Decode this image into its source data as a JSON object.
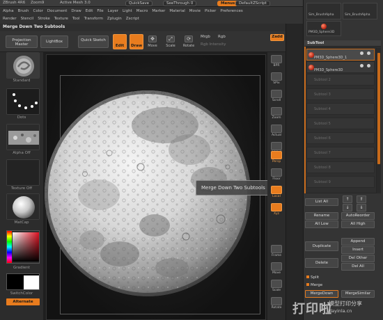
{
  "title_bar": {
    "items": [
      "ZBrush 4R6",
      "Zoom9",
      "Active Mesh 3.0"
    ],
    "quicksave": "QuickSave",
    "interface": "SeeThrough 0",
    "menus": "Menus",
    "script": "DefaultZScript"
  },
  "menu_rows": [
    [
      "Alpha",
      "Brush",
      "Color",
      "Document",
      "Draw",
      "Edit",
      "File",
      "Layer",
      "Light",
      "Macro",
      "Marker",
      "Material",
      "Movie",
      "Picker",
      "Preferences"
    ],
    [
      "Render",
      "Stencil",
      "Stroke",
      "Texture",
      "Tool",
      "Transform",
      "Zplugin",
      "Zscript"
    ]
  ],
  "palette_title": "Merge Down Two Subtools",
  "toolbar": {
    "projection_master": "Projection Master",
    "lightbox": "LightBox",
    "quick_sketch": "Quick Sketch",
    "edit": "Edit",
    "draw": "Draw",
    "move": "Move",
    "scale": "Scale",
    "rotate": "Rotate",
    "mrgb": "Mrgb",
    "rgb": "Rgb",
    "rgb_intensity": "Rgb Intensity",
    "zadd": "Zadd"
  },
  "left_shelf": {
    "captions": [
      "Standard",
      "Dots",
      "Alpha Off",
      "Texture Off",
      "MatCap",
      "Gradient",
      "SwitchColor",
      "Alternate"
    ]
  },
  "tooltip": "Merge Down Two Subtools",
  "right_tools": [
    {
      "label": "BPR",
      "icon": "render-icon",
      "active": false
    },
    {
      "label": "SPix",
      "icon": "spix-icon",
      "active": false
    },
    {
      "label": "Scroll",
      "icon": "scroll-icon",
      "active": false
    },
    {
      "label": "Zoom",
      "icon": "zoom-icon",
      "active": false
    },
    {
      "label": "Actual",
      "icon": "actual-icon",
      "active": false
    },
    {
      "label": "AAHalf",
      "icon": "aahalf-icon",
      "active": false
    },
    {
      "label": "Persp",
      "icon": "persp-icon",
      "active": true
    },
    {
      "label": "Floor",
      "icon": "floor-icon",
      "active": false
    },
    {
      "label": "Local",
      "icon": "local-icon",
      "active": true
    },
    {
      "label": "Xyz",
      "icon": "xyz-icon",
      "active": true
    },
    {
      "label": "Frame",
      "icon": "frame-icon",
      "active": false
    },
    {
      "label": "Move",
      "icon": "move-icon",
      "active": false
    },
    {
      "label": "Scale",
      "icon": "scale-icon",
      "active": false
    },
    {
      "label": "Rotate",
      "icon": "rotate-icon",
      "active": false
    }
  ],
  "right_panel": {
    "top_items": [
      "Sim_BrushAlpha",
      "Sim_BrushAlpha"
    ],
    "top_tool": "PM3D_Sphere3D",
    "subtool_header": "SubTool",
    "subtools": [
      {
        "name": "PM3D_Sphere3D_1",
        "selected": true
      },
      {
        "name": "PM3D_Sphere3D",
        "selected": false
      }
    ],
    "empty_slots": [
      "Subtool 2",
      "Subtool 3",
      "Subtool 4",
      "Subtool 5",
      "Subtool 6",
      "Subtool 7",
      "Subtool 8",
      "Subtool 9"
    ],
    "list_all": "List All",
    "rename": "Rename",
    "auto_reorder": "AutoReorder",
    "all_low": "All Low",
    "all_high": "All High",
    "duplicate": "Duplicate",
    "append": "Append",
    "insert": "Insert",
    "delete": "Delete",
    "del_other": "Del Other",
    "del_all": "Del All",
    "split": "Split",
    "merge": "Merge",
    "merge_down": "MergeDown",
    "merge_similar": "MergeSimilar"
  },
  "colors": {
    "accent": "#e87c1e",
    "panel": "#343434",
    "background": "#2a2a2a"
  },
  "watermark": {
    "logo": "打印啦",
    "text": "模型打印分享",
    "url": "dayinla.cn"
  }
}
